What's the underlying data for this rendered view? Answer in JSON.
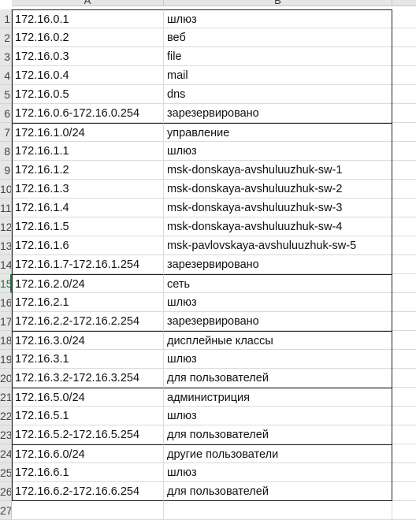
{
  "columns": [
    "A",
    "B"
  ],
  "rows": [
    {
      "num": "1",
      "ip": "172.16.0.1",
      "desc": "шлюз"
    },
    {
      "num": "2",
      "ip": "172.16.0.2",
      "desc": "веб"
    },
    {
      "num": "3",
      "ip": "172.16.0.3",
      "desc": "file"
    },
    {
      "num": "4",
      "ip": "172.16.0.4",
      "desc": "mail"
    },
    {
      "num": "5",
      "ip": "172.16.0.5",
      "desc": "dns"
    },
    {
      "num": "6",
      "ip": "172.16.0.6-172.16.0.254",
      "desc": "зарезервировано"
    },
    {
      "num": "7",
      "ip": "172.16.1.0/24",
      "desc": "управление"
    },
    {
      "num": "8",
      "ip": "172.16.1.1",
      "desc": "шлюз"
    },
    {
      "num": "9",
      "ip": "172.16.1.2",
      "desc": "msk-donskaya-avshuluuzhuk-sw-1"
    },
    {
      "num": "10",
      "ip": "172.16.1.3",
      "desc": "msk-donskaya-avshuluuzhuk-sw-2"
    },
    {
      "num": "11",
      "ip": "172.16.1.4",
      "desc": "msk-donskaya-avshuluuzhuk-sw-3"
    },
    {
      "num": "12",
      "ip": "172.16.1.5",
      "desc": "msk-donskaya-avshuluuzhuk-sw-4"
    },
    {
      "num": "13",
      "ip": "172.16.1.6",
      "desc": "msk-pavlovskaya-avshuluuzhuk-sw-5"
    },
    {
      "num": "14",
      "ip": "172.16.1.7-172.16.1.254",
      "desc": "зарезервировано"
    },
    {
      "num": "15",
      "ip": "172.16.2.0/24",
      "desc": "сеть"
    },
    {
      "num": "16",
      "ip": "172.16.2.1",
      "desc": "шлюз"
    },
    {
      "num": "17",
      "ip": "172.16.2.2-172.16.2.254",
      "desc": "зарезервировано"
    },
    {
      "num": "18",
      "ip": "172.16.3.0/24",
      "desc": "дисплейные классы"
    },
    {
      "num": "19",
      "ip": "172.16.3.1",
      "desc": "шлюз"
    },
    {
      "num": "20",
      "ip": "172.16.3.2-172.16.3.254",
      "desc": "для пользователей"
    },
    {
      "num": "21",
      "ip": "172.16.5.0/24",
      "desc": "администриция"
    },
    {
      "num": "22",
      "ip": "172.16.5.1",
      "desc": "шлюз"
    },
    {
      "num": "23",
      "ip": "172.16.5.2-172.16.5.254",
      "desc": "для пользователей"
    },
    {
      "num": "24",
      "ip": "172.16.6.0/24",
      "desc": "другие пользователи"
    },
    {
      "num": "25",
      "ip": "172.16.6.1",
      "desc": "шлюз"
    },
    {
      "num": "26",
      "ip": "172.16.6.2-172.16.6.254",
      "desc": "для пользователей"
    },
    {
      "num": "27",
      "ip": "",
      "desc": ""
    }
  ]
}
